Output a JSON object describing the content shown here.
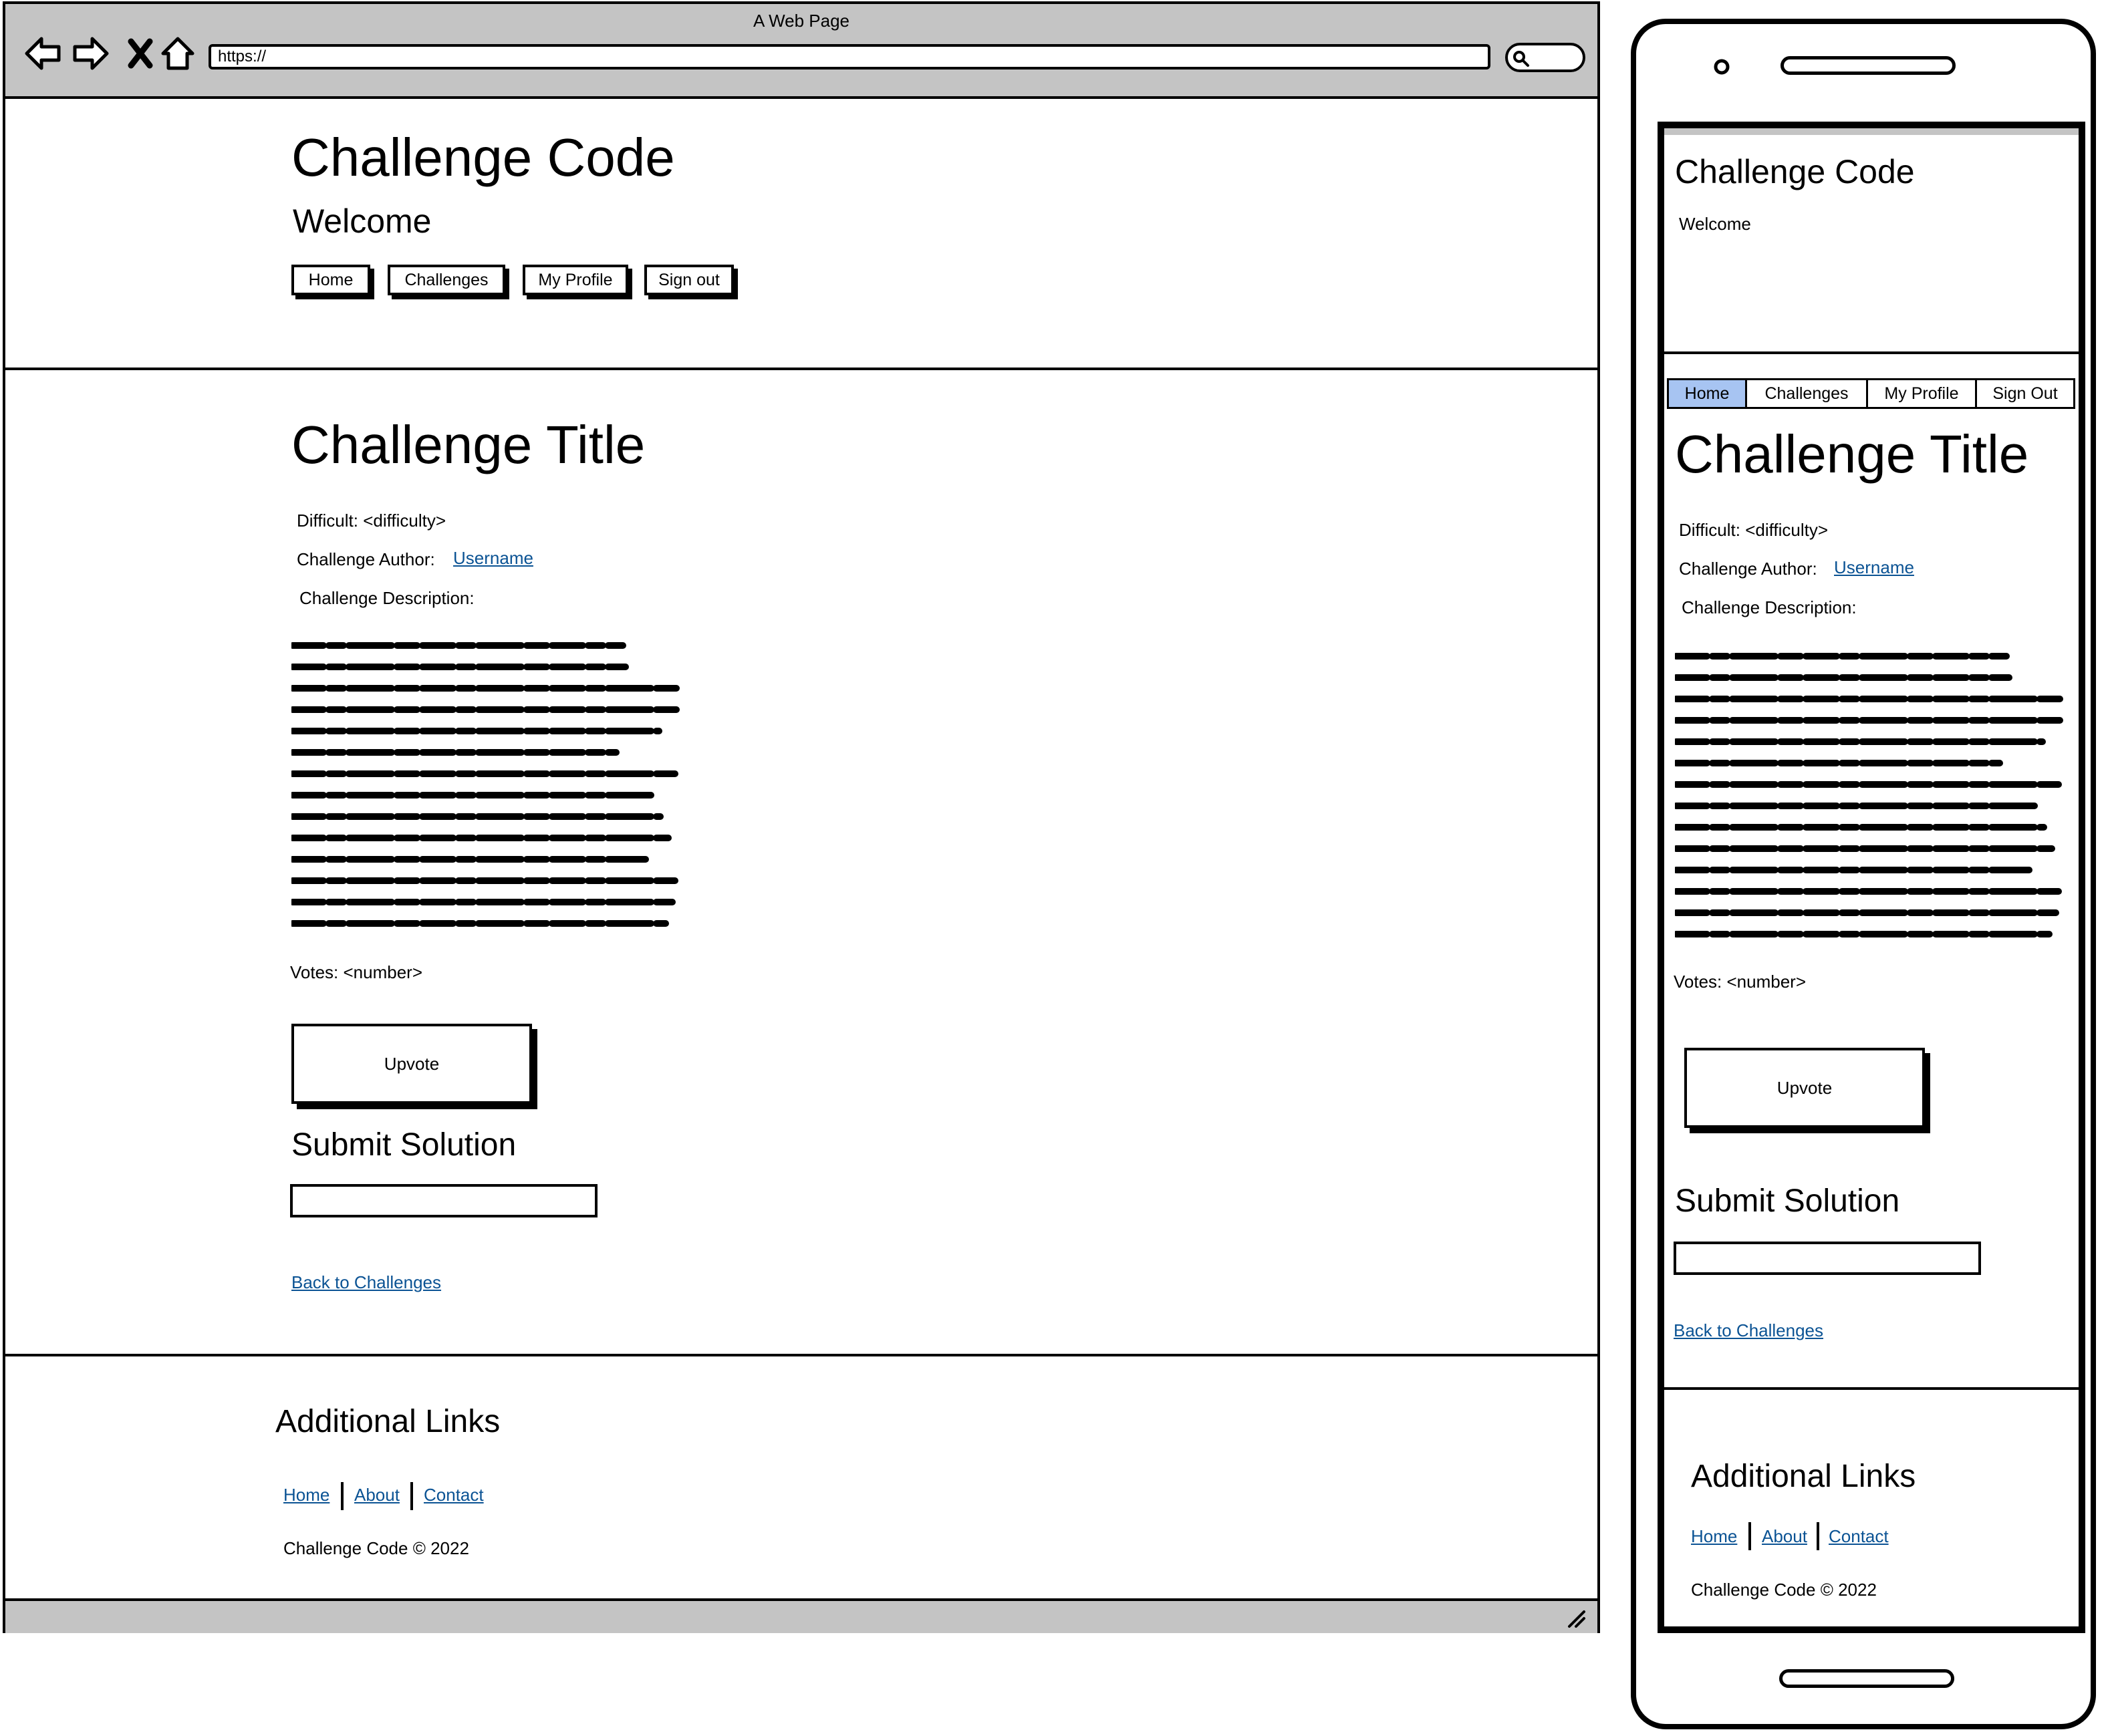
{
  "browser": {
    "title": "A Web Page",
    "url": "https://"
  },
  "site": {
    "title": "Challenge Code",
    "welcome": "Welcome",
    "nav": [
      "Home",
      "Challenges",
      "My Profile",
      "Sign out"
    ]
  },
  "challenge": {
    "title": "Challenge Title",
    "difficulty_label": "Difficult: <difficulty>",
    "author_label": "Challenge Author:",
    "author_name": "Username",
    "description_label": "Challenge Description:",
    "votes_label": "Votes: <number>",
    "upvote_label": "Upvote",
    "submit_heading": "Submit Solution",
    "back_link": "Back to Challenges"
  },
  "footer": {
    "heading": "Additional Links",
    "links": [
      "Home",
      "About",
      "Contact"
    ],
    "copyright": "Challenge Code © 2022"
  },
  "mobile": {
    "site_title": "Challenge Code",
    "welcome": "Welcome",
    "nav": [
      "Home",
      "Challenges",
      "My Profile",
      "Sign Out"
    ],
    "active_nav": "Home",
    "active_color": "#a7c4f2"
  },
  "icons": [
    "back-arrow-icon",
    "forward-arrow-icon",
    "close-icon",
    "home-icon",
    "search-icon",
    "resize-grip-icon"
  ]
}
